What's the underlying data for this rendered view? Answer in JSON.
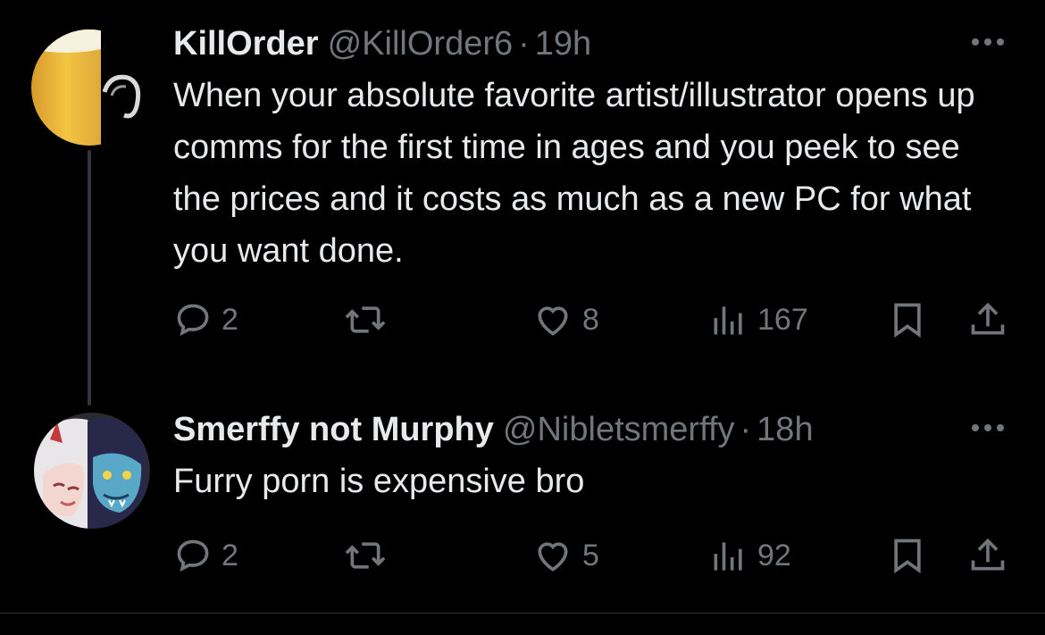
{
  "tweets": [
    {
      "display_name": "KillOrder",
      "handle": "@KillOrder6",
      "separator": "·",
      "time": "19h",
      "text": "When your absolute favorite artist/illustrator opens up comms for the first time in ages and you peek to see the prices and it costs as much as a new PC for what you want done.",
      "replies": "2",
      "likes": "8",
      "views": "167"
    },
    {
      "display_name": "Smerffy not Murphy",
      "handle": "@Nibletsmerffy",
      "separator": "·",
      "time": "18h",
      "text": "Furry porn is expensive bro",
      "replies": "2",
      "likes": "5",
      "views": "92"
    }
  ],
  "icons": {
    "reply": "speech-bubble-icon",
    "retweet": "retweet-icon",
    "like": "heart-icon",
    "views": "bar-chart-icon",
    "bookmark": "bookmark-icon",
    "share": "share-upload-icon",
    "more": "ellipsis-icon"
  },
  "colors": {
    "background": "#000000",
    "text_primary": "#e7e9ea",
    "text_secondary": "#71767b",
    "thread_line": "#333639",
    "divider": "#2f3336"
  }
}
